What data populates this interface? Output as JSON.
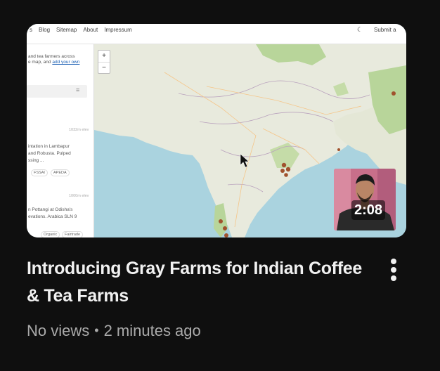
{
  "video": {
    "title": "Introducing Gray Farms for Indian Coffee & Tea Farms",
    "duration": "2:08",
    "views": "No views",
    "separator": "•",
    "age": "2 minutes ago"
  },
  "thumbnail": {
    "nav": [
      "s",
      "Blog",
      "Sitemap",
      "About",
      "Impressum"
    ],
    "submit_label": "Submit a",
    "moon_icon": "moon-icon",
    "zoom_in": "+",
    "zoom_out": "−",
    "side_text": {
      "intro_1": "and tea farmers across",
      "intro_2": "e map, and",
      "intro_link": "add your own",
      "filter_glyph": "≡",
      "item1_meta": "1032m elev",
      "item1_line1": "intation in Lambapur",
      "item1_line2": "and Robusta. Pulped",
      "item1_line3": "ssing ...",
      "tag1": "FSSAI",
      "tag2": "APEDA",
      "item2_meta": "1000m elev",
      "item2_line1": "n Pottangi at Odisha's",
      "item2_line2": "evations. Arabica SLN 9",
      "tag3": "Organic",
      "tag4": "Fairtrade"
    }
  },
  "colors": {
    "background": "#0f0f0f",
    "title": "#f1f1f1",
    "meta": "#aaaaaa",
    "sea": "#aad3df",
    "land": "#e8eadd",
    "forest": "#b8d59a",
    "marker": "#a0522d"
  }
}
